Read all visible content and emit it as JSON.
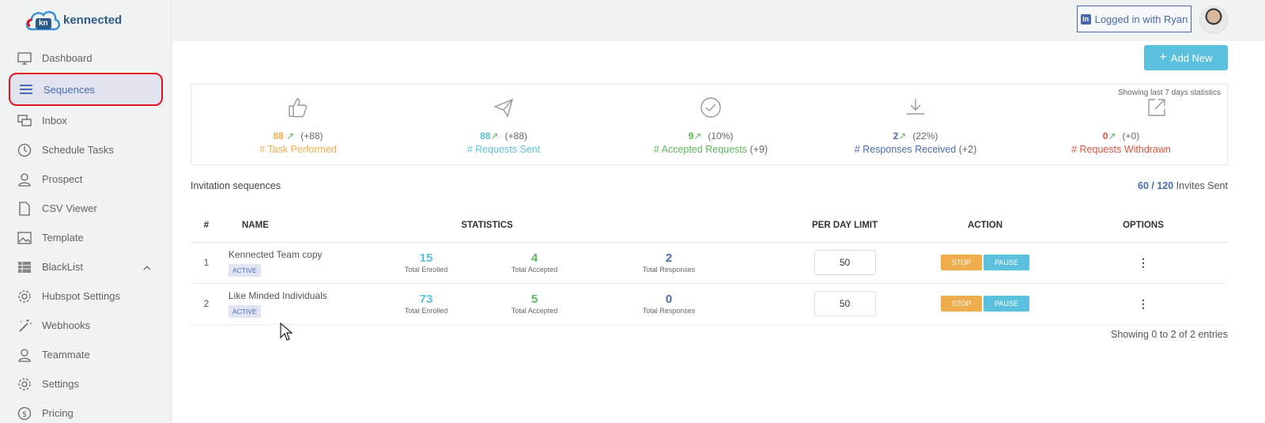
{
  "app": {
    "logo_mark": "kn",
    "brand": "kennected"
  },
  "sidebar": {
    "items": [
      {
        "label": "Dashboard",
        "icon": "monitor-icon"
      },
      {
        "label": "Sequences",
        "icon": "list-icon"
      },
      {
        "label": "Inbox",
        "icon": "chat-icon"
      },
      {
        "label": "Schedule Tasks",
        "icon": "clock-icon"
      },
      {
        "label": "Prospect",
        "icon": "user-icon"
      },
      {
        "label": "CSV Viewer",
        "icon": "file-icon"
      },
      {
        "label": "Template",
        "icon": "image-icon"
      },
      {
        "label": "BlackList",
        "icon": "grid-icon"
      },
      {
        "label": "Hubspot Settings",
        "icon": "gear-icon"
      },
      {
        "label": "Webhooks",
        "icon": "wand-icon"
      },
      {
        "label": "Teammate",
        "icon": "user-icon"
      },
      {
        "label": "Settings",
        "icon": "gear-icon"
      },
      {
        "label": "Pricing",
        "icon": "dollar-icon"
      }
    ],
    "active": "Sequences"
  },
  "topbar": {
    "login_label": "Logged in with Ryan",
    "login_icon": "in"
  },
  "toolbar": {
    "add_label": "Add New",
    "add_icon": "+"
  },
  "stats": {
    "note": "Showing last 7 days statistics",
    "items": [
      {
        "value": "88",
        "change": "(+88)",
        "label": "# Task Performed",
        "extra": "",
        "color": "#f0ad4e",
        "icon": "thumbs-up-icon"
      },
      {
        "value": "88",
        "change": "(+88)",
        "label": "# Requests Sent",
        "extra": "",
        "color": "#5bc0de",
        "icon": "paper-plane-icon"
      },
      {
        "value": "9",
        "change": "(10%)",
        "label": "# Accepted Requests",
        "extra": "(+9)",
        "color": "#5cb85c",
        "icon": "check-circle-icon"
      },
      {
        "value": "2",
        "change": "(22%)",
        "label": "# Responses Received",
        "extra": "(+2)",
        "color": "#4a6bb5",
        "icon": "download-icon"
      },
      {
        "value": "0",
        "change": "(+0)",
        "label": "# Requests Withdrawn",
        "extra": "",
        "color": "#e0543c",
        "icon": "external-link-icon"
      }
    ]
  },
  "section": {
    "title": "Invitation sequences",
    "invites_used": "60",
    "invites_total": "120",
    "invites_suffix": "Invites Sent"
  },
  "table": {
    "headers": {
      "num": "#",
      "name": "NAME",
      "statistics": "STATISTICS",
      "limit": "PER DAY LIMIT",
      "action": "ACTION",
      "options": "OPTIONS"
    },
    "rows": [
      {
        "num": "1",
        "name": "Kennected Team copy",
        "status": "ACTIVE",
        "enrolled": "15",
        "enrolled_label": "Total Enrolled",
        "accepted": "4",
        "accepted_label": "Total Accepted",
        "responses": "2",
        "responses_label": "Total Responses",
        "limit": "50",
        "stop": "STOP",
        "pause": "PAUSE",
        "options": "⋮"
      },
      {
        "num": "2",
        "name": "Like Minded Individuals",
        "status": "ACTIVE",
        "enrolled": "73",
        "enrolled_label": "Total Enrolled",
        "accepted": "5",
        "accepted_label": "Total Accepted",
        "responses": "0",
        "responses_label": "Total Responses",
        "limit": "50",
        "stop": "STOP",
        "pause": "PAUSE",
        "options": "⋮"
      }
    ]
  },
  "footer": {
    "entries": "Showing 0 to 2 of 2 entries"
  }
}
